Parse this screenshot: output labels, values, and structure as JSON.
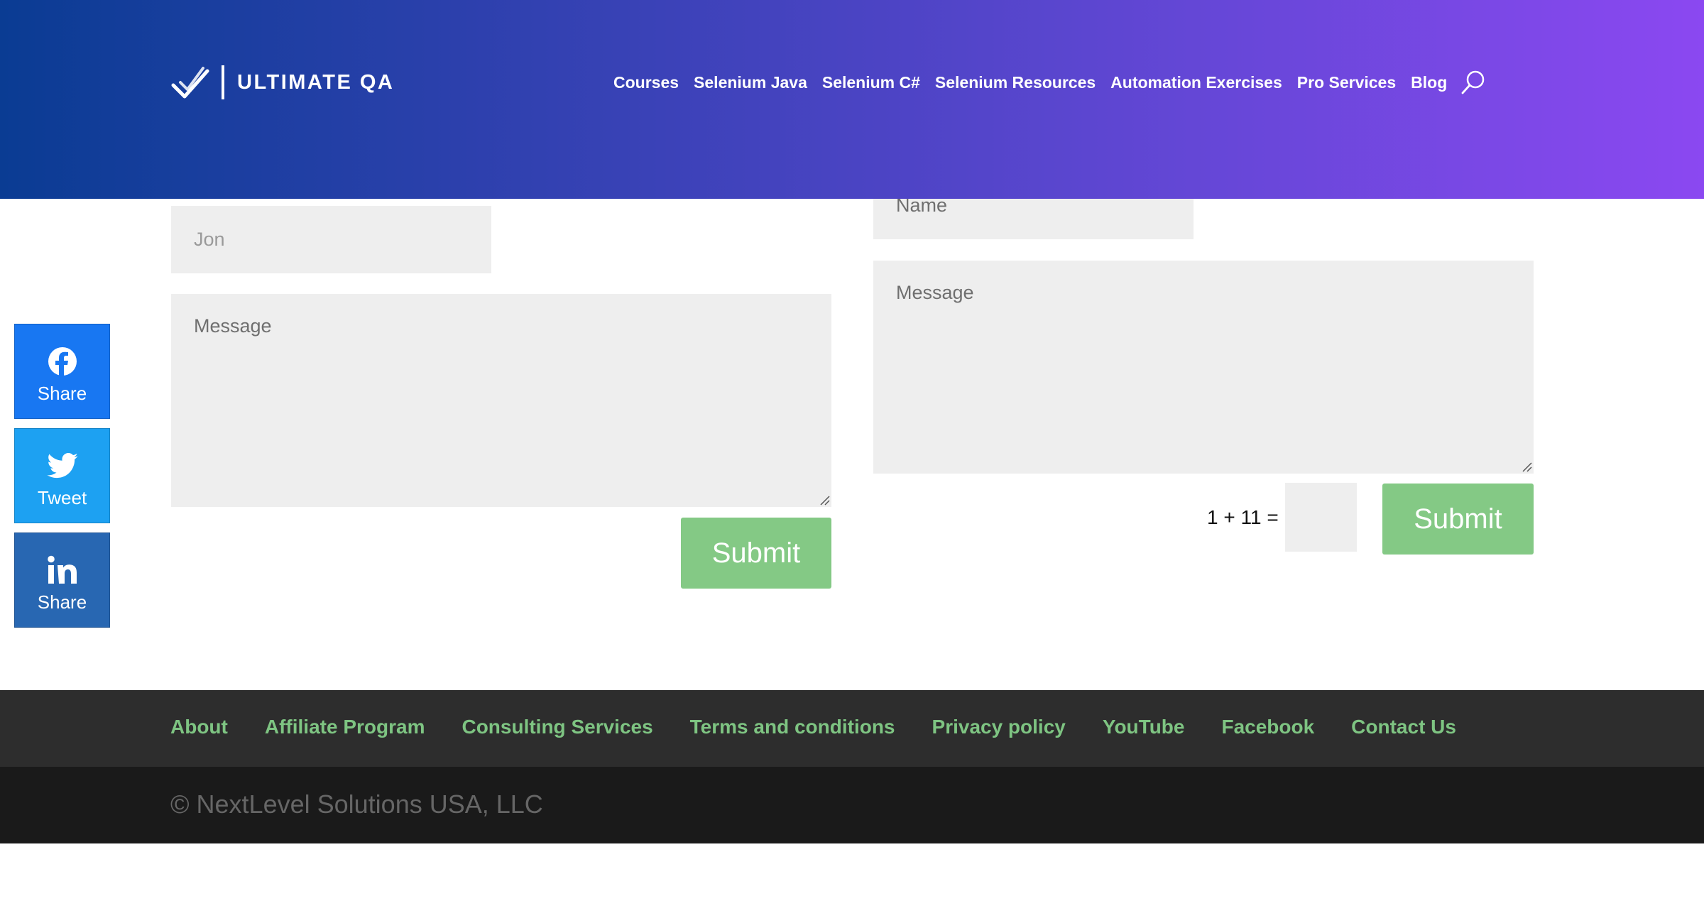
{
  "header": {
    "logo_text": "ULTIMATE QA",
    "nav": [
      "Courses",
      "Selenium Java",
      "Selenium C#",
      "Selenium Resources",
      "Automation Exercises",
      "Pro Services",
      "Blog"
    ]
  },
  "social": {
    "facebook_label": "Share",
    "twitter_label": "Tweet",
    "linkedin_label": "Share"
  },
  "left_form": {
    "name_value": "Jon",
    "message_placeholder": "Message",
    "submit_label": "Submit"
  },
  "right_form": {
    "name_placeholder": "Name",
    "message_placeholder": "Message",
    "captcha_question": "1 + 11 =",
    "submit_label": "Submit"
  },
  "footer": {
    "links": [
      "About",
      "Affiliate Program",
      "Consulting Services",
      "Terms and conditions",
      "Privacy policy",
      "YouTube",
      "Facebook",
      "Contact Us"
    ],
    "copyright": "© NextLevel Solutions USA, LLC"
  },
  "colors": {
    "header_gradient_start": "#0a3c93",
    "header_gradient_end": "#8b48f1",
    "submit_green": "#84c985",
    "footer_link_green": "#7ec482",
    "facebook_blue": "#1877f2",
    "twitter_blue": "#1da1f2",
    "linkedin_blue": "#2867b2"
  }
}
